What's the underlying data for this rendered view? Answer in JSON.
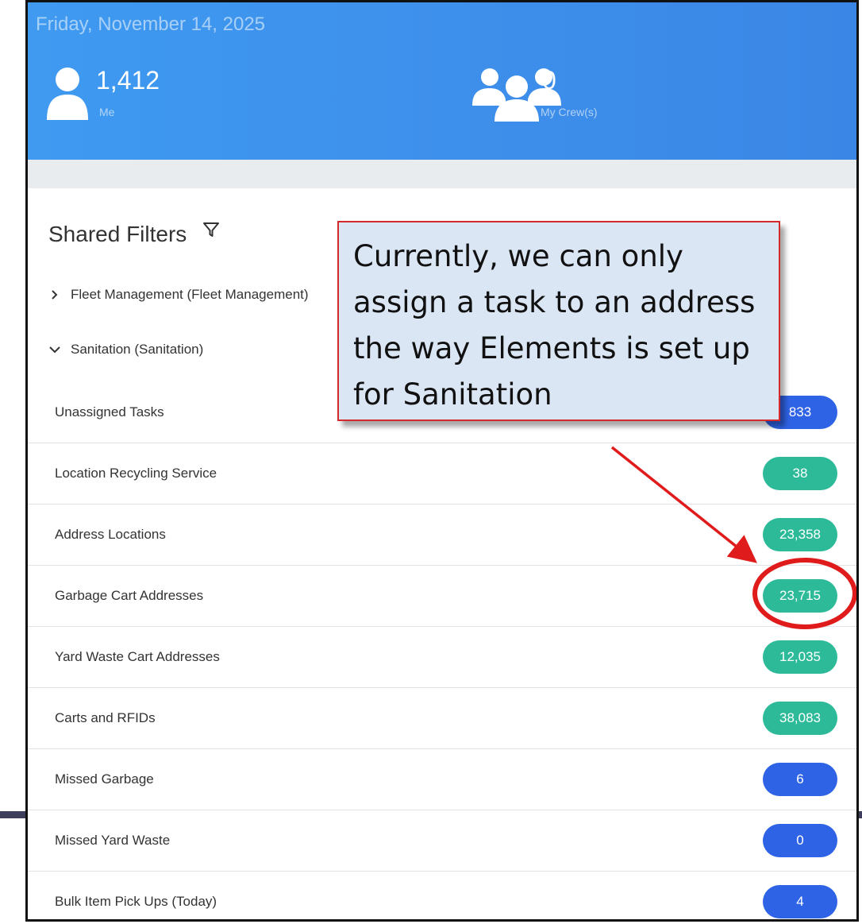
{
  "header": {
    "date": "Friday, November 14, 2025",
    "me": {
      "value": "1,412",
      "label": "Me",
      "icon": "person-icon"
    },
    "crew": {
      "value": "0",
      "label": "My Crew(s)",
      "icon": "group-icon"
    }
  },
  "shared_filters": {
    "title": "Shared Filters",
    "icon": "filter-icon",
    "groups": [
      {
        "label": "Fleet Management (Fleet Management)",
        "expanded": false
      },
      {
        "label": "Sanitation (Sanitation)",
        "expanded": true
      }
    ],
    "items": [
      {
        "label": "Unassigned Tasks",
        "count": "833",
        "color": "#2f63e6"
      },
      {
        "label": "Location Recycling Service",
        "count": "38",
        "color": "#2cba98"
      },
      {
        "label": "Address Locations",
        "count": "23,358",
        "color": "#2cba98"
      },
      {
        "label": "Garbage Cart Addresses",
        "count": "23,715",
        "color": "#2cba98"
      },
      {
        "label": "Yard Waste Cart Addresses",
        "count": "12,035",
        "color": "#2cba98"
      },
      {
        "label": "Carts and RFIDs",
        "count": "38,083",
        "color": "#2cba98"
      },
      {
        "label": "Missed Garbage",
        "count": "6",
        "color": "#2f63e6"
      },
      {
        "label": "Missed Yard Waste",
        "count": "0",
        "color": "#2f63e6"
      },
      {
        "label": "Bulk Item Pick Ups (Today)",
        "count": "4",
        "color": "#2f63e6"
      }
    ]
  },
  "callout": {
    "lines": [
      "Currently, we can only",
      "assign a task to an address",
      "the way Elements is set up",
      "for Sanitation"
    ],
    "border_color": "#d62a2a"
  }
}
